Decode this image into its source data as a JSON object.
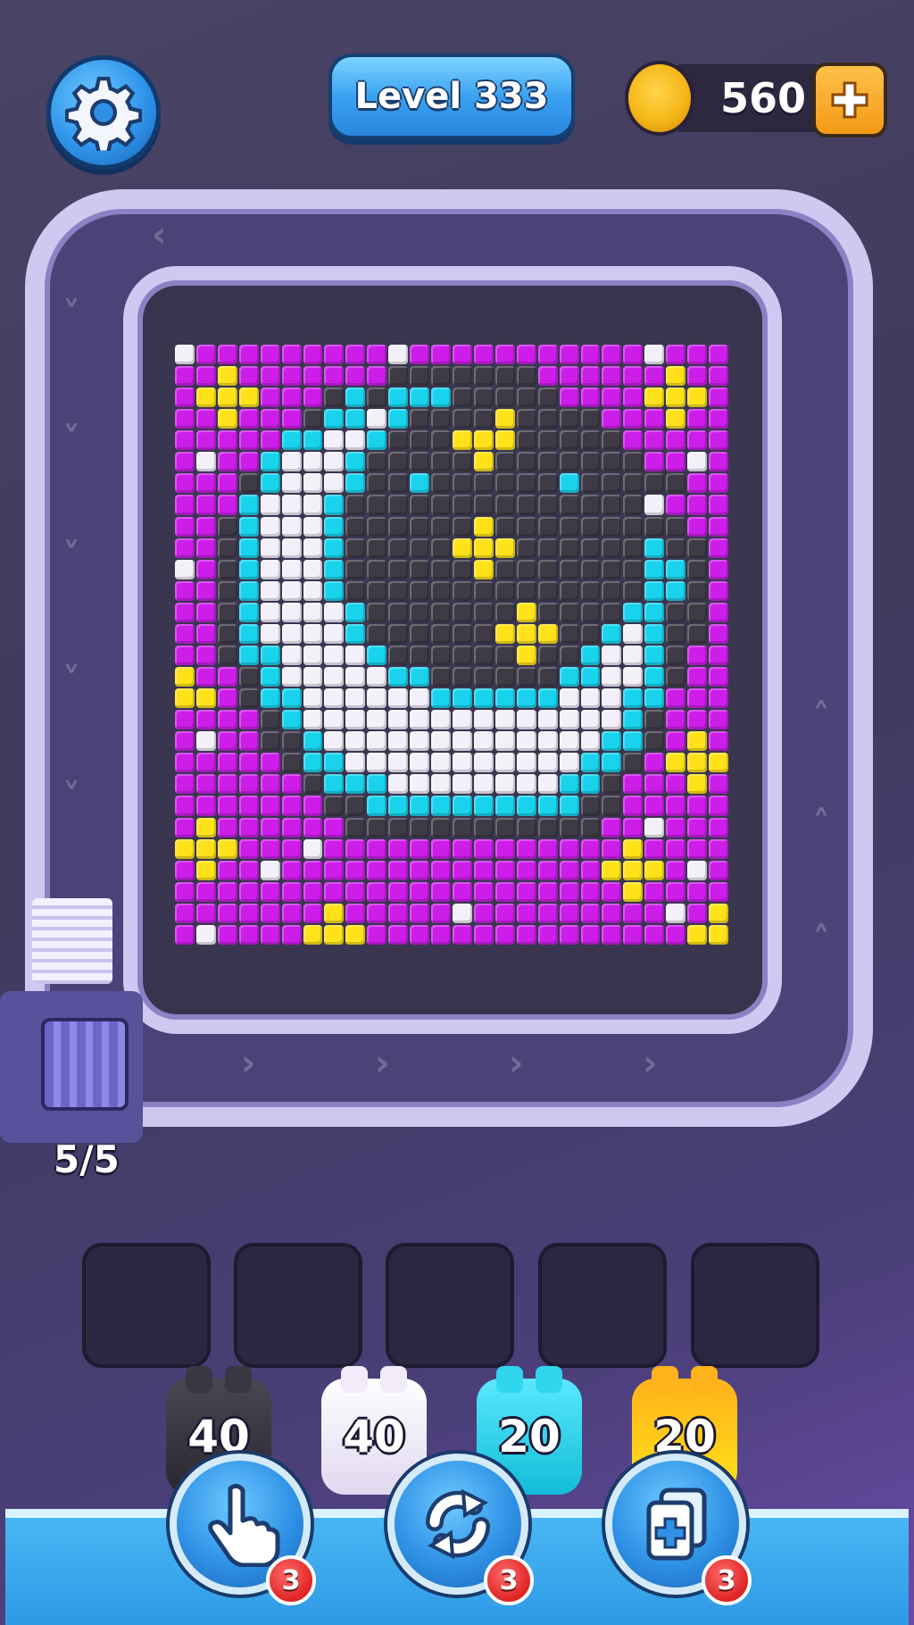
{
  "header": {
    "level_label": "Level 333",
    "coins": "560"
  },
  "conveyor": {
    "capacity": "5/5"
  },
  "colors": {
    "magenta": "#cc1ee8",
    "dark": "#3e3a46",
    "cyan": "#19d3ec",
    "white": "#f4f0fa",
    "yellow": "#ffe21a",
    "orange": "#ff9f1a"
  },
  "pieces": [
    {
      "color": "dark",
      "count": "40"
    },
    {
      "color": "white",
      "count": "40"
    },
    {
      "color": "cyan",
      "count": "20"
    },
    {
      "color": "yellow",
      "count": "20"
    }
  ],
  "boosters": [
    {
      "name": "tap",
      "icon": "hand-pointer-icon",
      "count": "3"
    },
    {
      "name": "shuffle",
      "icon": "refresh-icon",
      "count": "3"
    },
    {
      "name": "add-slot",
      "icon": "add-card-icon",
      "count": "3"
    }
  ],
  "grid": {
    "cols": 26,
    "rows": 28,
    "palette": {
      "M": "#cc1ee8",
      "D": "#3e3a46",
      "C": "#19d3ec",
      "W": "#f4f0fa",
      "Y": "#ffe21a"
    },
    "cells": [
      "WMMMMMMMMMWMMMMMMMMMMMWMMM",
      "MMYMMMMMMMDDDDDDDMMMMMMYMM",
      "MYYYMMMDCDCCCDDDDDMMMMYYYM",
      "MMYMMMDCCWCDDDDYDDDDMMMYMM",
      "MMMMMCCWWCDDDYYYDDDDDMMMMM",
      "MWMMCWWWCDDDDDYDDDDDDDMMWM",
      "MMMDCWWWCDDCDDDDDDCDDDDDMM",
      "MMMCWWWCDDDDDDDDDDDDDDWMMM",
      "MMDCWWWCDDDDDDYDDDDDDDDDMM",
      "MMDCWWWCDDDDDYYYDDDDDDCDDM",
      "WMDCWWWCDDDDDDYDDDDDDDCCDM",
      "MMDCWWWCDDDDDDDDDDDDDDCCDM",
      "MMDCWWWWCDDDDDDDYDDDDCCDDM",
      "MMDCWWWWCDDDDDDYYYDDCWCDDM",
      "MMDCCWWWWCDDDDDDYDDCWWCDMM",
      "YMMDCWWWWWCCDDDDDDCCWWCDMM",
      "YYMDCCWWWWWWCCCCCCWWWCCMMM",
      "MMMMDCWWWWWWWWWWWWWWWCDMMM",
      "MWMMDDCWWWWWWWWWWWWWCCDMYM",
      "MMMMMDCCWWWWWWWWWWWCCDMYYY",
      "MMMMMMDCCCWWWWWWWWCCDMMMYM",
      "MMMMMMMDDCCCCCCCCCCDDMMMMM",
      "MYMMMMMMDDDDDDDDDDDDMMWMMM",
      "YYYMMMWMMMMMMMMMMMMMMYMMMM",
      "MYMMWMMMMMMMMMMMMMMMYYYMWM",
      "MMMMMMMMMMMMMMMMMMMMMYMMMM",
      "MMMMMMMYMMMMMWMMMMMMMMMWMY",
      "MWMMMMYYYMMMMMMMMMMMMMMMYY"
    ]
  }
}
